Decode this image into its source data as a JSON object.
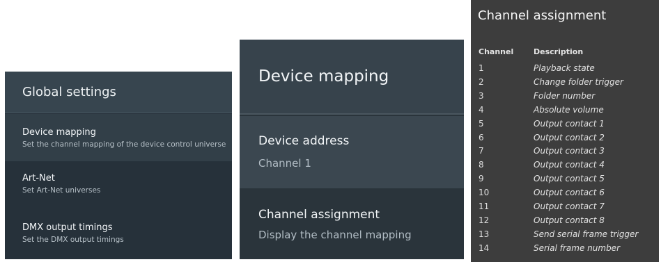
{
  "global_settings": {
    "title": "Global settings",
    "items": [
      {
        "title": "Device mapping",
        "subtitle": "Set the channel mapping of the device control universe"
      },
      {
        "title": "Art-Net",
        "subtitle": "Set Art-Net universes"
      },
      {
        "title": "DMX output timings",
        "subtitle": "Set the DMX output timings"
      }
    ]
  },
  "device_mapping": {
    "title": "Device mapping",
    "items": [
      {
        "title": "Device address",
        "subtitle": "Channel 1"
      },
      {
        "title": "Channel assignment",
        "subtitle": "Display the channel mapping"
      }
    ]
  },
  "channel_assignment": {
    "title": "Channel assignment",
    "headers": {
      "channel": "Channel",
      "description": "Description"
    },
    "rows": [
      {
        "channel": "1",
        "description": "Playback state"
      },
      {
        "channel": "2",
        "description": "Change folder trigger"
      },
      {
        "channel": "3",
        "description": "Folder number"
      },
      {
        "channel": "4",
        "description": "Absolute volume"
      },
      {
        "channel": "5",
        "description": "Output contact 1"
      },
      {
        "channel": "6",
        "description": "Output contact 2"
      },
      {
        "channel": "7",
        "description": "Output contact 3"
      },
      {
        "channel": "8",
        "description": "Output contact 4"
      },
      {
        "channel": "9",
        "description": "Output contact 5"
      },
      {
        "channel": "10",
        "description": "Output contact 6"
      },
      {
        "channel": "11",
        "description": "Output contact 7"
      },
      {
        "channel": "12",
        "description": "Output contact 8"
      },
      {
        "channel": "13",
        "description": "Send serial frame trigger"
      },
      {
        "channel": "14",
        "description": "Serial frame number"
      }
    ]
  }
}
